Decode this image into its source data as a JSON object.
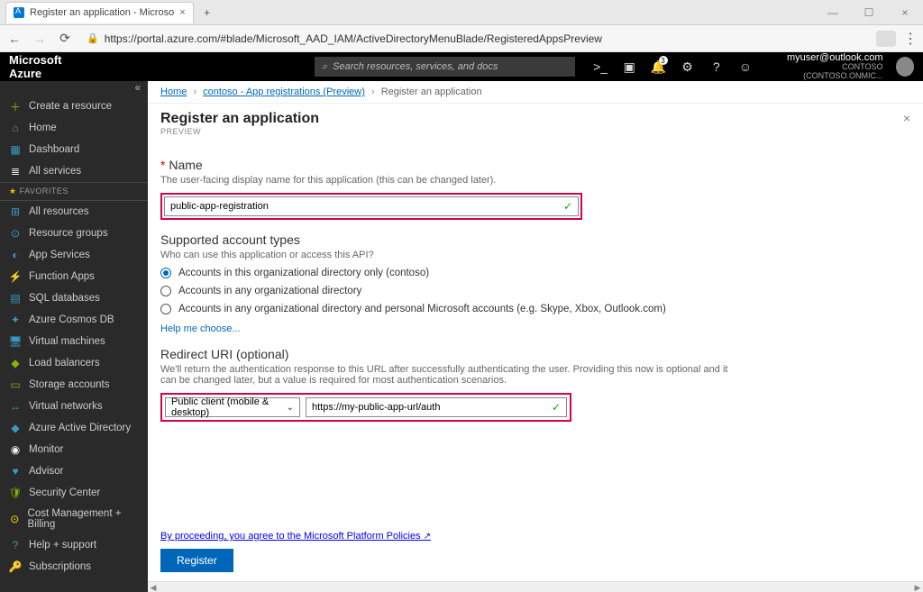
{
  "browser": {
    "tab_title": "Register an application - Microso",
    "url": "https://portal.azure.com/#blade/Microsoft_AAD_IAM/ActiveDirectoryMenuBlade/RegisteredAppsPreview"
  },
  "azurebar": {
    "brand": "Microsoft Azure",
    "search_placeholder": "Search resources, services, and docs",
    "notification_count": "3",
    "user_email": "myuser@outlook.com",
    "user_tenant": "CONTOSO (CONTOSO.ONMIC..."
  },
  "sidebar": {
    "items_top": [
      {
        "icon": "＋",
        "label": "Create a resource",
        "cls": "c-green",
        "name": "create-resource"
      },
      {
        "icon": "⌂",
        "label": "Home",
        "cls": "c-blue",
        "name": "home"
      },
      {
        "icon": "▦",
        "label": "Dashboard",
        "cls": "c-blue",
        "name": "dashboard"
      },
      {
        "icon": "≣",
        "label": "All services",
        "cls": "c-white",
        "name": "all-services"
      }
    ],
    "favorites_label": "FAVORITES",
    "items": [
      {
        "icon": "⊞",
        "label": "All resources",
        "cls": "c-blue",
        "name": "all-resources"
      },
      {
        "icon": "⊙",
        "label": "Resource groups",
        "cls": "c-blue",
        "name": "resource-groups"
      },
      {
        "icon": "◐",
        "label": "App Services",
        "cls": "c-blue",
        "name": "app-services"
      },
      {
        "icon": "⚡",
        "label": "Function Apps",
        "cls": "c-orange",
        "name": "function-apps"
      },
      {
        "icon": "▤",
        "label": "SQL databases",
        "cls": "c-blue",
        "name": "sql-databases"
      },
      {
        "icon": "✦",
        "label": "Azure Cosmos DB",
        "cls": "c-blue",
        "name": "cosmos-db"
      },
      {
        "icon": "🖥",
        "label": "Virtual machines",
        "cls": "c-blue",
        "name": "virtual-machines"
      },
      {
        "icon": "◆",
        "label": "Load balancers",
        "cls": "c-green",
        "name": "load-balancers"
      },
      {
        "icon": "▭",
        "label": "Storage accounts",
        "cls": "c-green",
        "name": "storage-accounts"
      },
      {
        "icon": "↔",
        "label": "Virtual networks",
        "cls": "c-blue",
        "name": "virtual-networks"
      },
      {
        "icon": "◆",
        "label": "Azure Active Directory",
        "cls": "c-blue",
        "name": "azure-ad"
      },
      {
        "icon": "◉",
        "label": "Monitor",
        "cls": "c-white",
        "name": "monitor"
      },
      {
        "icon": "♥",
        "label": "Advisor",
        "cls": "c-blue",
        "name": "advisor"
      },
      {
        "icon": "🛡",
        "label": "Security Center",
        "cls": "c-green",
        "name": "security-center"
      },
      {
        "icon": "⊙",
        "label": "Cost Management + Billing",
        "cls": "c-yellow",
        "name": "cost-billing"
      },
      {
        "icon": "?",
        "label": "Help + support",
        "cls": "c-blue",
        "name": "help-support"
      },
      {
        "icon": "🔑",
        "label": "Subscriptions",
        "cls": "c-yellow",
        "name": "subscriptions"
      }
    ]
  },
  "breadcrumbs": {
    "home": "Home",
    "mid": "contoso - App registrations (Preview)",
    "current": "Register an application"
  },
  "blade": {
    "title": "Register an application",
    "subtitle": "PREVIEW"
  },
  "name_section": {
    "heading": "Name",
    "desc": "The user-facing display name for this application (this can be changed later).",
    "value": "public-app-registration"
  },
  "account_types": {
    "heading": "Supported account types",
    "desc": "Who can use this application or access this API?",
    "options": [
      "Accounts in this organizational directory only (contoso)",
      "Accounts in any organizational directory",
      "Accounts in any organizational directory and personal Microsoft accounts (e.g. Skype, Xbox, Outlook.com)"
    ],
    "help_link": "Help me choose..."
  },
  "redirect": {
    "heading": "Redirect URI (optional)",
    "desc": "We'll return the authentication response to this URL after successfully authenticating the user. Providing this now is optional and it can be changed later, but a value is required for most authentication scenarios.",
    "select_value": "Public client (mobile & desktop)",
    "uri_value": "https://my-public-app-url/auth"
  },
  "footer": {
    "agree_text": "By proceeding, you agree to the Microsoft Platform Policies",
    "ext_icon": "↗",
    "register_label": "Register"
  }
}
